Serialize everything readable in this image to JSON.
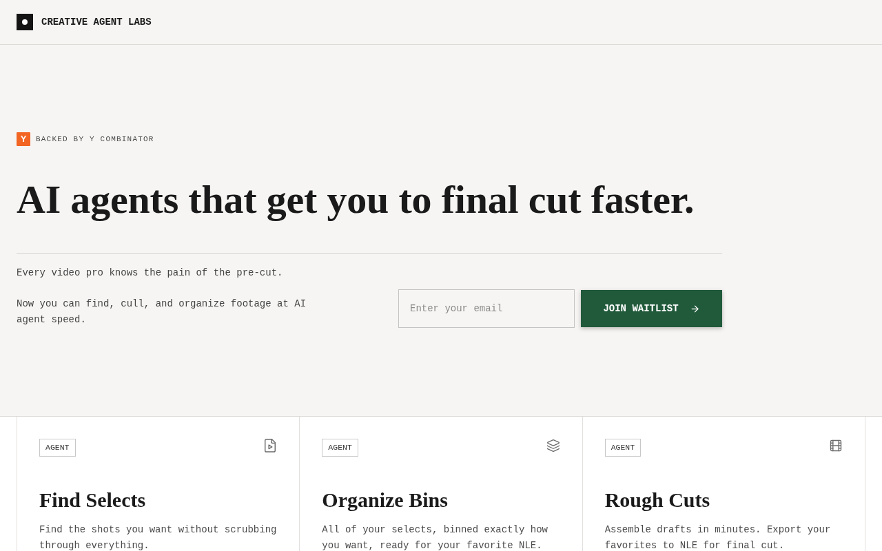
{
  "header": {
    "brand": "CREATIVE AGENT LABS"
  },
  "hero": {
    "badge": {
      "logo_letter": "Y",
      "label": "BACKED BY Y COMBINATOR"
    },
    "headline": "AI agents that get you to final cut faster.",
    "paragraphs": [
      "Every video pro knows the pain of the pre-cut.",
      "Now you can find, cull, and organize footage at AI agent speed."
    ],
    "signup": {
      "email_field": {
        "placeholder": "Enter your email"
      },
      "button": "JOIN WAITLIST"
    }
  },
  "cards": [
    {
      "tag": "AGENT",
      "title": "Find Selects",
      "description": "Find the shots you want without scrubbing through everything."
    },
    {
      "tag": "AGENT",
      "title": "Organize Bins",
      "description": "All of your selects, binned exactly how you want, ready for your favorite NLE."
    },
    {
      "tag": "AGENT",
      "title": "Rough Cuts",
      "description": "Assemble drafts in minutes. Export your favorites to NLE for final cut."
    }
  ]
}
